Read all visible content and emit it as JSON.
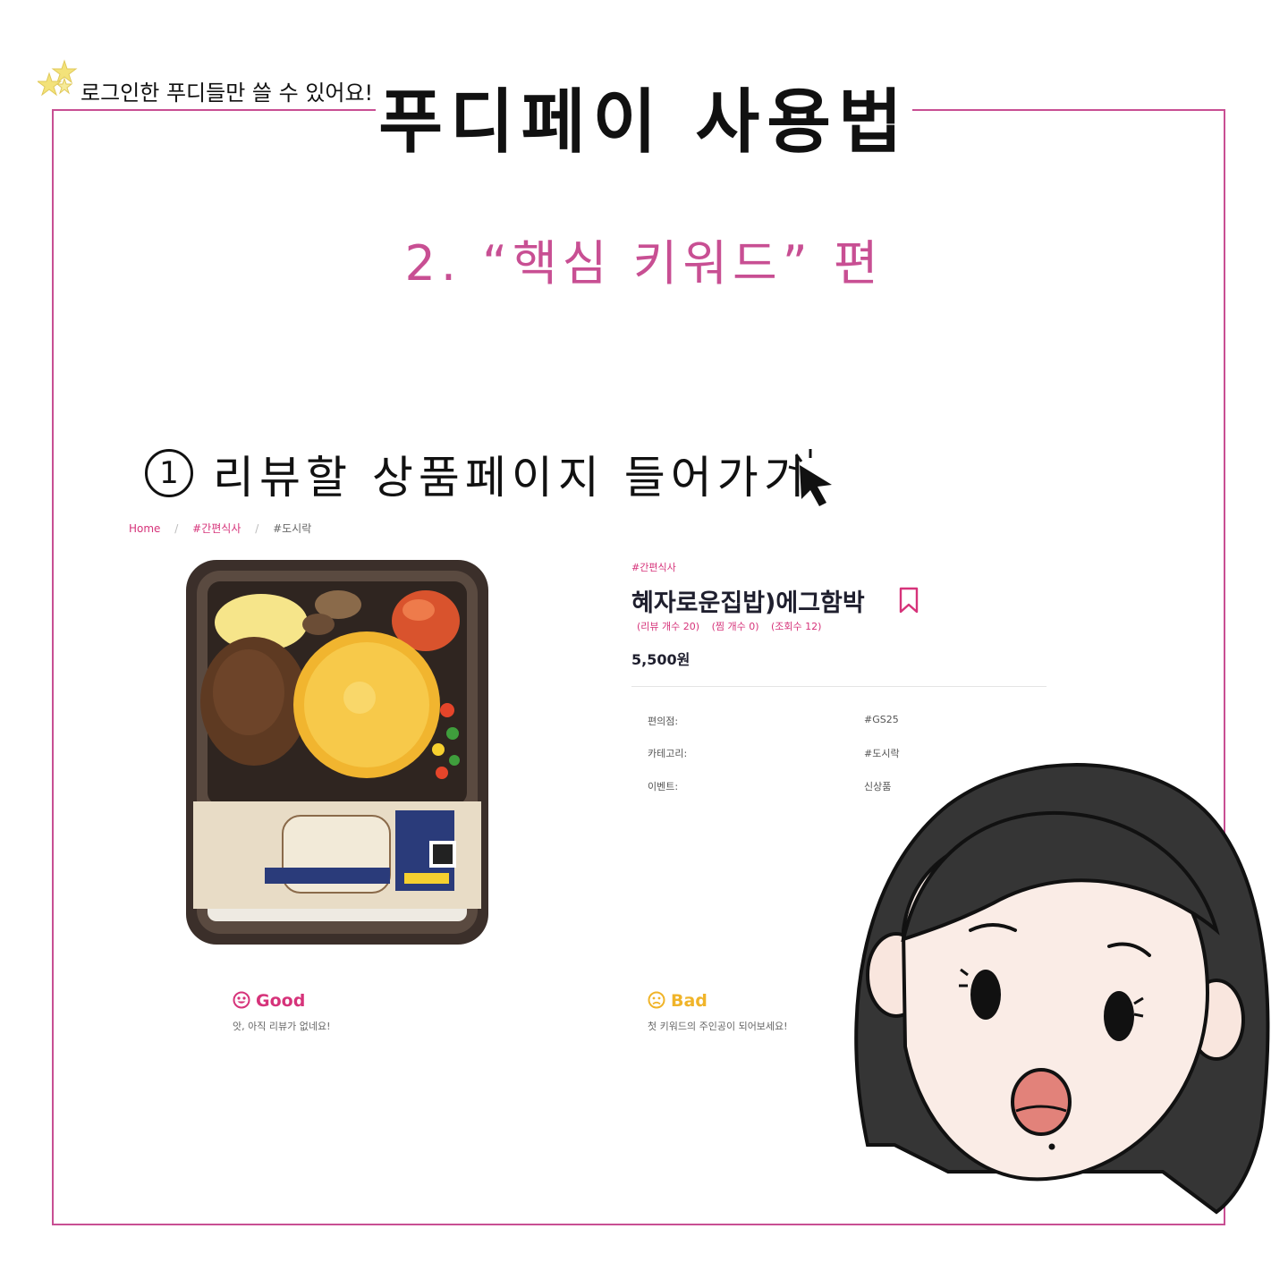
{
  "header": {
    "login_note": "로그인한 푸디들만 쓸 수 있어요!",
    "title": "푸디페이 사용법",
    "subtitle": "2. “핵심 키워드” 편"
  },
  "step": {
    "number": "1",
    "text": "리뷰할 상품페이지 들어가기"
  },
  "breadcrumb": {
    "home": "Home",
    "category": "#간편식사",
    "current": "#도시락",
    "separator": "/"
  },
  "product": {
    "category_tag": "#간편식사",
    "name": "혜자로운집밥)에그함박",
    "review_count": "(리뷰 개수 20)",
    "like_count": "(찜 개수 0)",
    "view_count": "(조회수 12)",
    "price": "5,500원",
    "info": [
      {
        "label": "편의점:",
        "value": "#GS25"
      },
      {
        "label": "카테고리:",
        "value": "#도시락"
      },
      {
        "label": "이벤트:",
        "value": "신상품"
      }
    ]
  },
  "reviews": {
    "good_title": "Good",
    "good_empty": "앗, 아직 리뷰가 없네요!",
    "bad_title": "Bad",
    "bad_empty": "첫 키워드의 주인공이 되어보세요!"
  },
  "colors": {
    "accent_pink": "#d6337a",
    "frame_pink": "#c84f93",
    "bad_yellow": "#f0b429",
    "text_dark": "#1f1f2e"
  }
}
